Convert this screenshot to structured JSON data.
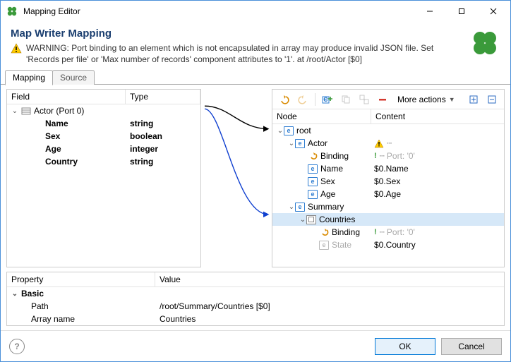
{
  "window": {
    "title": "Mapping Editor"
  },
  "header": {
    "title": "Map Writer Mapping",
    "warning": "WARNING: Port binding to an element which is not encapsulated in array may produce invalid JSON file. Set 'Records per file' or 'Max number of records' component attributes to '1'. at /root/Actor [$0]"
  },
  "tabs": {
    "mapping": "Mapping",
    "source": "Source"
  },
  "left": {
    "hdr_field": "Field",
    "hdr_type": "Type",
    "group": "Actor (Port 0)",
    "rows": [
      {
        "name": "Name",
        "type": "string"
      },
      {
        "name": "Sex",
        "type": "boolean"
      },
      {
        "name": "Age",
        "type": "integer"
      },
      {
        "name": "Country",
        "type": "string"
      }
    ]
  },
  "toolbar": {
    "more": "More actions"
  },
  "right": {
    "hdr_node": "Node",
    "hdr_content": "Content",
    "root": "root",
    "actor": "Actor",
    "binding": "Binding",
    "port0": "Port: '0'",
    "name": "Name",
    "name_c": "$0.Name",
    "sex": "Sex",
    "sex_c": "$0.Sex",
    "age": "Age",
    "age_c": "$0.Age",
    "summary": "Summary",
    "countries": "Countries",
    "state": "State",
    "state_c": "$0.Country"
  },
  "prop": {
    "hdr_prop": "Property",
    "hdr_val": "Value",
    "group": "Basic",
    "path": "Path",
    "path_v": "/root/Summary/Countries [$0]",
    "arr": "Array name",
    "arr_v": "Countries"
  },
  "footer": {
    "ok": "OK",
    "cancel": "Cancel"
  }
}
